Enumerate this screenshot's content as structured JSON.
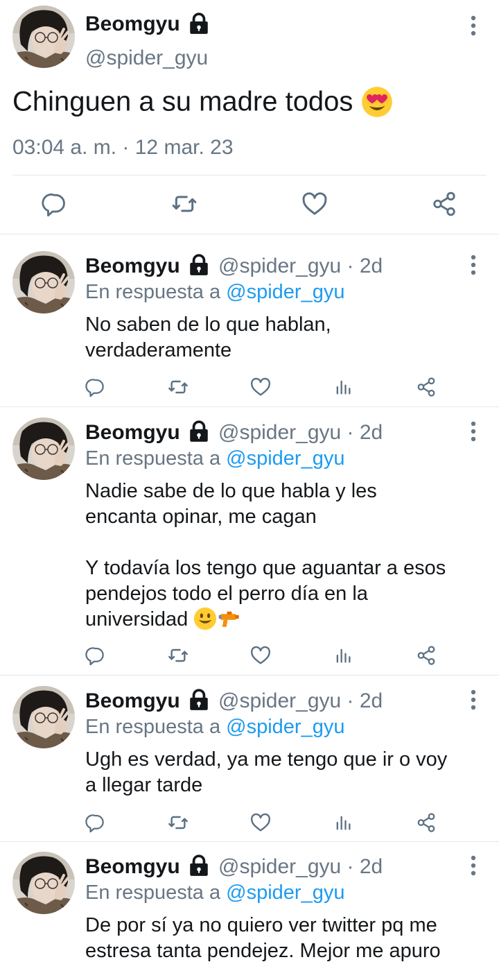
{
  "main_tweet": {
    "name": "Beomgyu",
    "handle": "@spider_gyu",
    "text": "Chinguen a su madre todos",
    "emoji": "heart-eyes",
    "timestamp": "03:04 a. m. · 12 mar. 23"
  },
  "replies": [
    {
      "name": "Beomgyu",
      "handle_time": "@spider_gyu · 2d",
      "reply_prefix": "En respuesta a ",
      "reply_to": "@spider_gyu",
      "lines": [
        "No saben de lo que hablan,",
        "verdaderamente"
      ]
    },
    {
      "name": "Beomgyu",
      "handle_time": "@spider_gyu · 2d",
      "reply_prefix": "En respuesta a ",
      "reply_to": "@spider_gyu",
      "lines": [
        "Nadie sabe de lo que habla y les",
        "encanta opinar, me cagan",
        "",
        "Y todavía los tengo que aguantar a esos",
        "pendejos todo el perro día en la",
        "universidad"
      ],
      "emojis": [
        "smiley",
        "water-pistol"
      ]
    },
    {
      "name": "Beomgyu",
      "handle_time": "@spider_gyu · 2d",
      "reply_prefix": "En respuesta a ",
      "reply_to": "@spider_gyu",
      "lines": [
        "Ugh es verdad, ya me tengo que ir o voy",
        "a llegar tarde"
      ]
    },
    {
      "name": "Beomgyu",
      "handle_time": "@spider_gyu · 2d",
      "reply_prefix": "En respuesta a ",
      "reply_to": "@spider_gyu",
      "lines": [
        "De por sí ya no quiero ver twitter pq me",
        "estresa tanta pendejez. Mejor me apuro"
      ]
    }
  ],
  "icons": {
    "reply": "reply-icon",
    "retweet": "retweet-icon",
    "like": "heart-icon",
    "stats": "stats-icon",
    "share": "share-icon",
    "more": "more-vertical-icon",
    "lock": "lock-icon"
  },
  "colors": {
    "link": "#1d9bf0",
    "secondary": "#687684",
    "text": "#14171a"
  }
}
